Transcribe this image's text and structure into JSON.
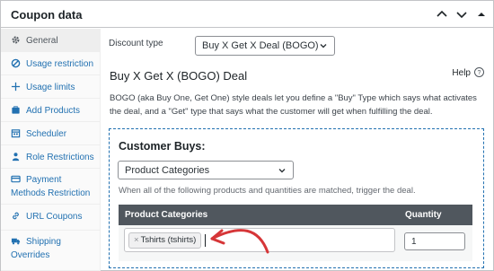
{
  "panel": {
    "title": "Coupon data"
  },
  "sidebar": {
    "items": [
      {
        "label": "General",
        "icon": "gear-icon",
        "active": true
      },
      {
        "label": "Usage restriction",
        "icon": "block-icon"
      },
      {
        "label": "Usage limits",
        "icon": "plus-icon"
      },
      {
        "label": "Add Products",
        "icon": "cart-icon"
      },
      {
        "label": "Scheduler",
        "icon": "calendar-icon"
      },
      {
        "label": "Role Restrictions",
        "icon": "person-icon"
      },
      {
        "label": "Payment Methods Restriction",
        "icon": "card-icon"
      },
      {
        "label": "URL Coupons",
        "icon": "link-icon"
      },
      {
        "label": "Shipping Overrides",
        "icon": "truck-icon"
      }
    ]
  },
  "main": {
    "discount_type_label": "Discount type",
    "discount_type_value": "Buy X Get X Deal (BOGO)",
    "section_title": "Buy X Get X (BOGO) Deal",
    "help_label": "Help",
    "description": "BOGO (aka Buy One, Get One) style deals let you define a \"Buy\" Type which says what activates the deal, and a \"Get\" type that says what the customer will get when fulfilling the deal.",
    "customer_buys": {
      "title": "Customer Buys:",
      "type_value": "Product Categories",
      "hint": "When all of the following products and quantities are matched, trigger the deal.",
      "columns": [
        "Product Categories",
        "Quantity"
      ],
      "row": {
        "tag": "Tshirts (tshirts)",
        "tag_remove": "×",
        "quantity": "1"
      }
    }
  },
  "colors": {
    "accent": "#2271b1",
    "arrow": "#d63638",
    "table_header": "#50575e"
  }
}
